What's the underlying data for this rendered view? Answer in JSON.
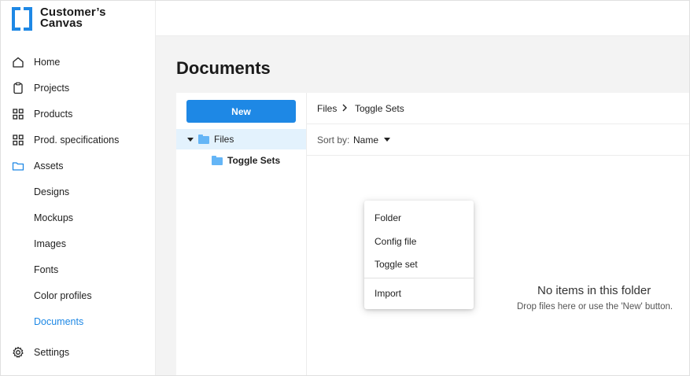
{
  "app": {
    "logo_line1": "Customer’s",
    "logo_line2": "Canvas",
    "brand_color": "#1e88e5"
  },
  "sidebar": {
    "items": [
      {
        "label": "Home",
        "icon": "home-icon"
      },
      {
        "label": "Projects",
        "icon": "clipboard-icon"
      },
      {
        "label": "Products",
        "icon": "grid-icon"
      },
      {
        "label": "Prod. specifications",
        "icon": "grid-icon"
      },
      {
        "label": "Assets",
        "icon": "folder-icon"
      },
      {
        "label": "Designs"
      },
      {
        "label": "Mockups"
      },
      {
        "label": "Images"
      },
      {
        "label": "Fonts"
      },
      {
        "label": "Color profiles"
      },
      {
        "label": "Documents",
        "active": true
      },
      {
        "label": "Settings",
        "icon": "gear-icon"
      }
    ]
  },
  "main": {
    "title": "Documents",
    "new_button": "New",
    "tree": [
      {
        "label": "Files",
        "expanded": true,
        "selected": true
      },
      {
        "label": "Toggle Sets"
      }
    ],
    "breadcrumb": [
      "Files",
      "Toggle Sets"
    ],
    "sort_label": "Sort by:",
    "sort_value": "Name",
    "empty_title": "No items in this folder",
    "empty_subtitle": "Drop files here or use the 'New' button."
  },
  "new_menu": {
    "items": [
      "Folder",
      "Config file",
      "Toggle set"
    ],
    "import": "Import"
  }
}
